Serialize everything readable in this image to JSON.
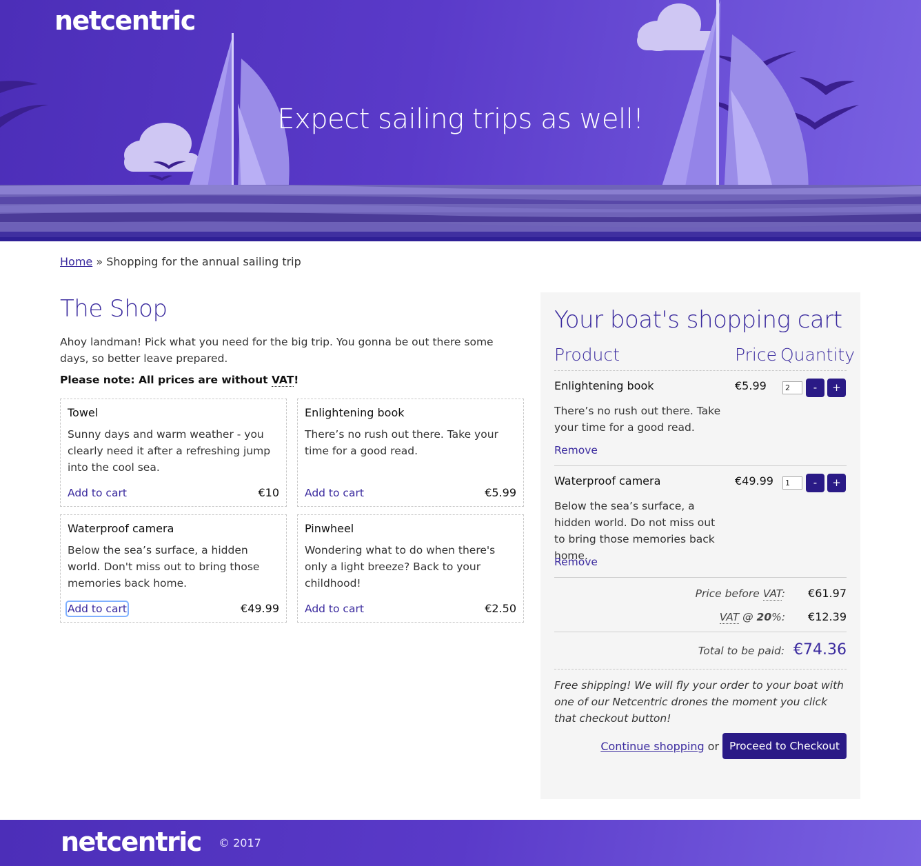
{
  "header": {
    "logo": "netcentric",
    "hero_title": "Expect sailing trips as well!"
  },
  "breadcrumb": {
    "home": "Home",
    "separator": "»",
    "current": "Shopping for the annual sailing trip"
  },
  "shop": {
    "title": "The Shop",
    "intro": "Ahoy landman! Pick what you need for the big trip. You gonna be out there some days, so better leave prepared.",
    "note_prefix": "Please note: All prices are without ",
    "note_abbr": "VAT",
    "note_suffix": "!",
    "add_label": "Add to cart",
    "products": [
      {
        "name": "Towel",
        "description": "Sunny days and warm weather - you clearly need it after a refreshing jump into the cool sea.",
        "price": "€10"
      },
      {
        "name": "Enlightening book",
        "description": "There’s no rush out there. Take your time for a good read.",
        "price": "€5.99"
      },
      {
        "name": "Waterproof camera",
        "description": "Below the sea’s surface, a hidden world. Don't miss out to bring those memories back home.",
        "price": "€49.99"
      },
      {
        "name": "Pinwheel",
        "description": "Wondering what to do when there's only a light breeze? Back to your childhood!",
        "price": "€2.50"
      }
    ]
  },
  "cart": {
    "title": "Your boat's shopping cart",
    "col_product": "Product",
    "col_price": "Price",
    "col_quantity": "Quantity",
    "minus_label": "-",
    "plus_label": "+",
    "remove_label": "Remove",
    "items": [
      {
        "name": "Enlightening book",
        "price": "€5.99",
        "quantity": "2",
        "description": "There’s no rush out there. Take your time for a good read."
      },
      {
        "name": "Waterproof camera",
        "price": "€49.99",
        "quantity": "1",
        "description": "Below the sea’s surface, a hidden world. Do not miss out to bring those memories back home."
      }
    ],
    "price_before_vat_label": "Price before ",
    "price_before_vat_abbr": "VAT",
    "price_before_vat_colon": ":",
    "price_before_vat": "€61.97",
    "vat_abbr": "VAT",
    "vat_at": " @ ",
    "vat_rate": "20",
    "vat_suffix": "%:",
    "vat_value": "€12.39",
    "total_label": "Total to be paid:",
    "total_value": "€74.36",
    "shipping_note": "Free shipping! We will fly your order to your boat with one of our Netcentric drones the moment you click that checkout button!",
    "continue_label": "Continue shopping",
    "or_label": "or",
    "checkout_label": "Proceed to Checkout"
  },
  "footer": {
    "logo": "netcentric",
    "copyright": "© 2017"
  },
  "colors": {
    "brand_purple": "#3a2a9e",
    "button_purple": "#2a1a86",
    "hero_start": "#4c2eb8",
    "hero_end": "#7a62e2"
  }
}
